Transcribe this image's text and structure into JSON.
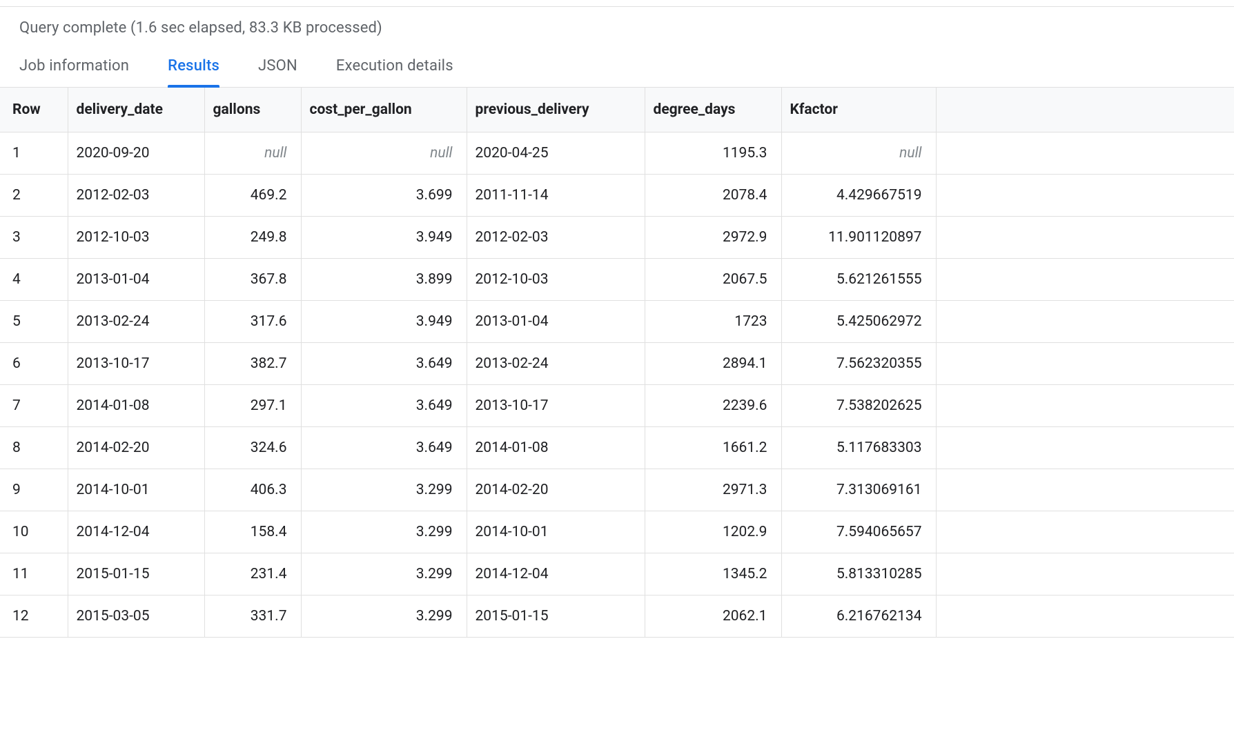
{
  "status_text": "Query complete (1.6 sec elapsed, 83.3 KB processed)",
  "tabs": [
    {
      "label": "Job information",
      "active": false
    },
    {
      "label": "Results",
      "active": true
    },
    {
      "label": "JSON",
      "active": false
    },
    {
      "label": "Execution details",
      "active": false
    }
  ],
  "columns": [
    {
      "key": "row",
      "header": "Row",
      "cls": "col-row"
    },
    {
      "key": "delivery_date",
      "header": "delivery_date",
      "cls": "col-date"
    },
    {
      "key": "gallons",
      "header": "gallons",
      "cls": "col-gallons"
    },
    {
      "key": "cost_per_gallon",
      "header": "cost_per_gallon",
      "cls": "col-cost"
    },
    {
      "key": "previous_delivery",
      "header": "previous_delivery",
      "cls": "col-prev"
    },
    {
      "key": "degree_days",
      "header": "degree_days",
      "cls": "col-degree"
    },
    {
      "key": "Kfactor",
      "header": "Kfactor",
      "cls": "col-kfactor"
    },
    {
      "key": "_empty",
      "header": "",
      "cls": "col-empty"
    }
  ],
  "null_label": "null",
  "rows": [
    {
      "row": "1",
      "delivery_date": "2020-09-20",
      "gallons": null,
      "cost_per_gallon": null,
      "previous_delivery": "2020-04-25",
      "degree_days": "1195.3",
      "Kfactor": null
    },
    {
      "row": "2",
      "delivery_date": "2012-02-03",
      "gallons": "469.2",
      "cost_per_gallon": "3.699",
      "previous_delivery": "2011-11-14",
      "degree_days": "2078.4",
      "Kfactor": "4.429667519"
    },
    {
      "row": "3",
      "delivery_date": "2012-10-03",
      "gallons": "249.8",
      "cost_per_gallon": "3.949",
      "previous_delivery": "2012-02-03",
      "degree_days": "2972.9",
      "Kfactor": "11.901120897"
    },
    {
      "row": "4",
      "delivery_date": "2013-01-04",
      "gallons": "367.8",
      "cost_per_gallon": "3.899",
      "previous_delivery": "2012-10-03",
      "degree_days": "2067.5",
      "Kfactor": "5.621261555"
    },
    {
      "row": "5",
      "delivery_date": "2013-02-24",
      "gallons": "317.6",
      "cost_per_gallon": "3.949",
      "previous_delivery": "2013-01-04",
      "degree_days": "1723",
      "Kfactor": "5.425062972"
    },
    {
      "row": "6",
      "delivery_date": "2013-10-17",
      "gallons": "382.7",
      "cost_per_gallon": "3.649",
      "previous_delivery": "2013-02-24",
      "degree_days": "2894.1",
      "Kfactor": "7.562320355"
    },
    {
      "row": "7",
      "delivery_date": "2014-01-08",
      "gallons": "297.1",
      "cost_per_gallon": "3.649",
      "previous_delivery": "2013-10-17",
      "degree_days": "2239.6",
      "Kfactor": "7.538202625"
    },
    {
      "row": "8",
      "delivery_date": "2014-02-20",
      "gallons": "324.6",
      "cost_per_gallon": "3.649",
      "previous_delivery": "2014-01-08",
      "degree_days": "1661.2",
      "Kfactor": "5.117683303"
    },
    {
      "row": "9",
      "delivery_date": "2014-10-01",
      "gallons": "406.3",
      "cost_per_gallon": "3.299",
      "previous_delivery": "2014-02-20",
      "degree_days": "2971.3",
      "Kfactor": "7.313069161"
    },
    {
      "row": "10",
      "delivery_date": "2014-12-04",
      "gallons": "158.4",
      "cost_per_gallon": "3.299",
      "previous_delivery": "2014-10-01",
      "degree_days": "1202.9",
      "Kfactor": "7.594065657"
    },
    {
      "row": "11",
      "delivery_date": "2015-01-15",
      "gallons": "231.4",
      "cost_per_gallon": "3.299",
      "previous_delivery": "2014-12-04",
      "degree_days": "1345.2",
      "Kfactor": "5.813310285"
    },
    {
      "row": "12",
      "delivery_date": "2015-03-05",
      "gallons": "331.7",
      "cost_per_gallon": "3.299",
      "previous_delivery": "2015-01-15",
      "degree_days": "2062.1",
      "Kfactor": "6.216762134"
    }
  ]
}
